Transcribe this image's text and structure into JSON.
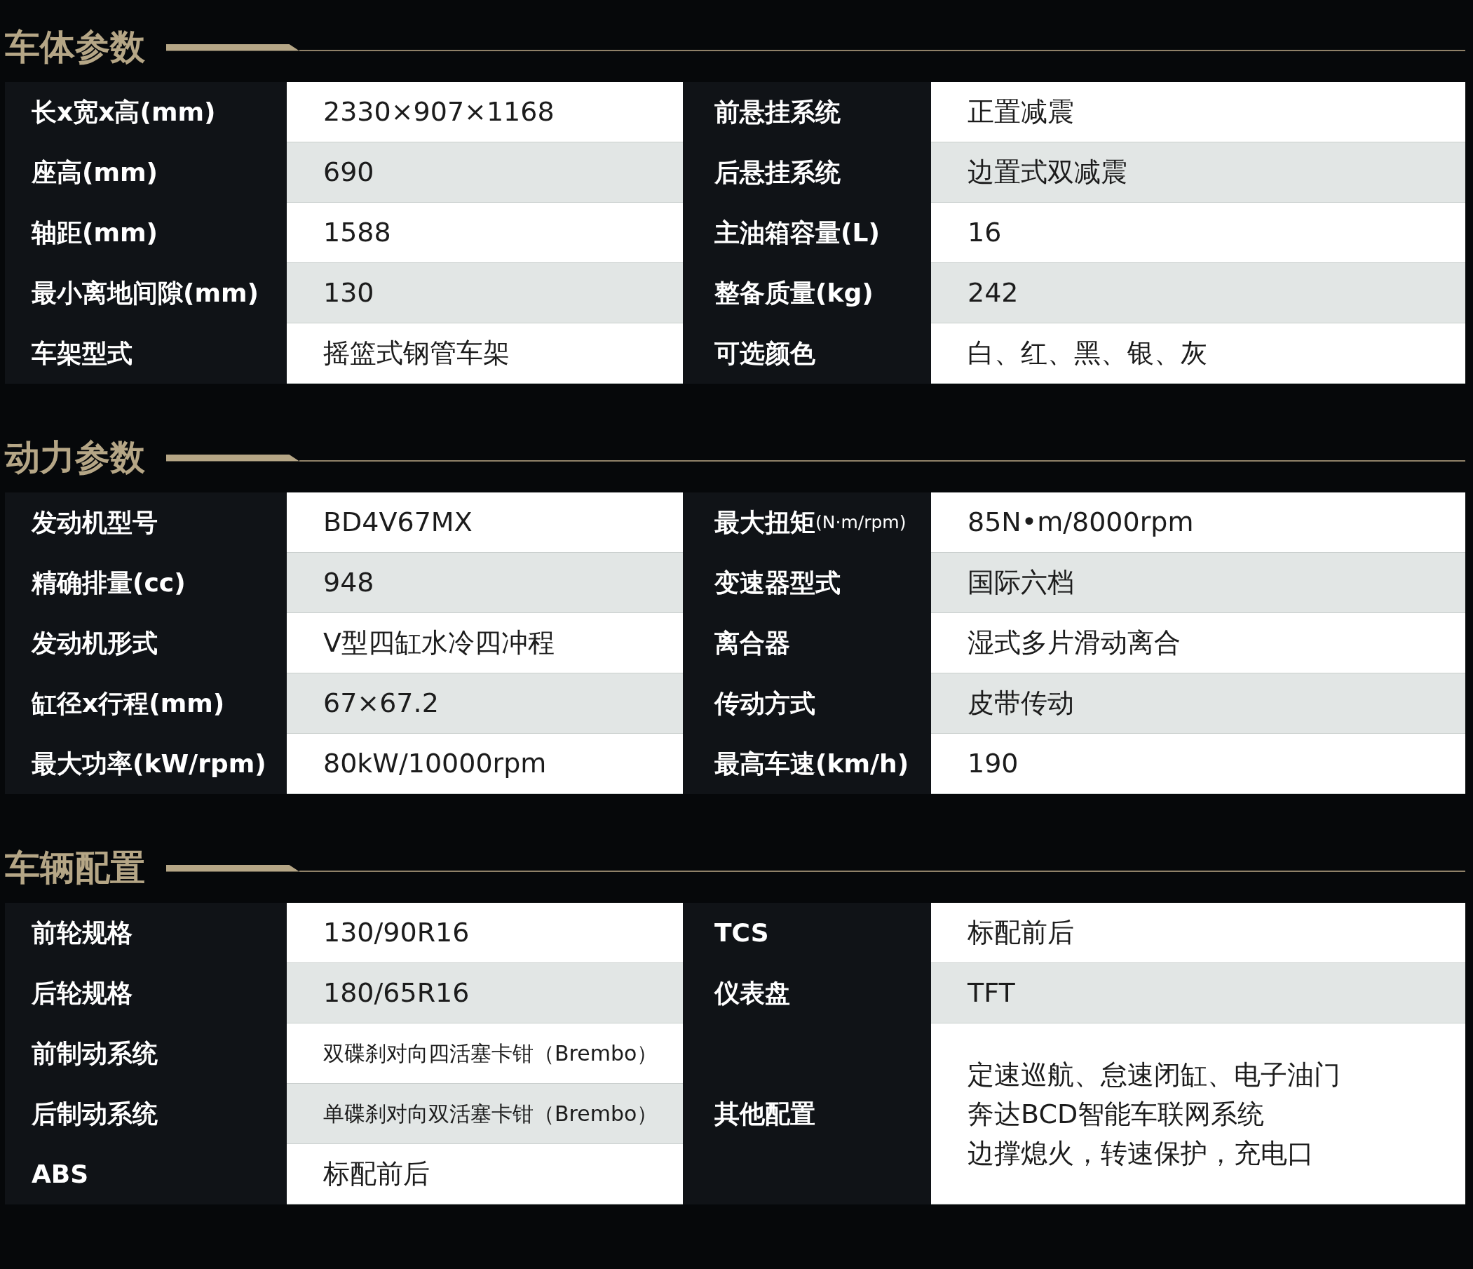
{
  "sections": [
    {
      "title": "车体参数",
      "left": [
        {
          "label": "长x宽x高(mm)",
          "value": "2330×907×1168"
        },
        {
          "label": "座高(mm)",
          "value": "690"
        },
        {
          "label": "轴距(mm)",
          "value": "1588"
        },
        {
          "label": "最小离地间隙(mm)",
          "value": "130"
        },
        {
          "label": "车架型式",
          "value": "摇篮式钢管车架"
        }
      ],
      "right": [
        {
          "label": "前悬挂系统",
          "value": "正置减震"
        },
        {
          "label": "后悬挂系统",
          "value": "边置式双减震"
        },
        {
          "label": "主油箱容量(L)",
          "value": "16"
        },
        {
          "label": "整备质量(kg)",
          "value": "242"
        },
        {
          "label": "可选颜色",
          "value": "白、红、黑、银、灰"
        }
      ]
    },
    {
      "title": "动力参数",
      "left": [
        {
          "label": "发动机型号",
          "value": "BD4V67MX"
        },
        {
          "label": "精确排量(cc)",
          "value": "948"
        },
        {
          "label": "发动机形式",
          "value": "V型四缸水冷四冲程"
        },
        {
          "label": "缸径x行程(mm)",
          "value": "67×67.2"
        },
        {
          "label": "最大功率(kW/rpm)",
          "value": "80kW/10000rpm"
        }
      ],
      "right": [
        {
          "label": "最大扭矩",
          "label_unit": "(N·m/rpm)",
          "value": "85N•m/8000rpm"
        },
        {
          "label": "变速器型式",
          "value": "国际六档"
        },
        {
          "label": "离合器",
          "value": "湿式多片滑动离合"
        },
        {
          "label": "传动方式",
          "value": "皮带传动"
        },
        {
          "label": "最高车速(km/h)",
          "value": "190"
        }
      ]
    },
    {
      "title": "车辆配置",
      "left": [
        {
          "label": "前轮规格",
          "value": "130/90R16"
        },
        {
          "label": "后轮规格",
          "value": "180/65R16"
        },
        {
          "label": "前制动系统",
          "value": "双碟刹对向四活塞卡钳（Brembo）",
          "kind": "compact"
        },
        {
          "label": "后制动系统",
          "value": "单碟刹对向双活塞卡钳（Brembo）",
          "kind": "compact"
        },
        {
          "label": "ABS",
          "value": "标配前后"
        }
      ],
      "right": [
        {
          "label": "TCS",
          "value": "标配前后"
        },
        {
          "label": "仪表盘",
          "value": "TFT"
        },
        {
          "label": "其他配置",
          "kind": "tall",
          "lines": [
            "定速巡航、怠速闭缸、电子油门",
            "奔达BCD智能车联网系统",
            "边撑熄火，转速保护，充电口"
          ]
        }
      ]
    }
  ]
}
